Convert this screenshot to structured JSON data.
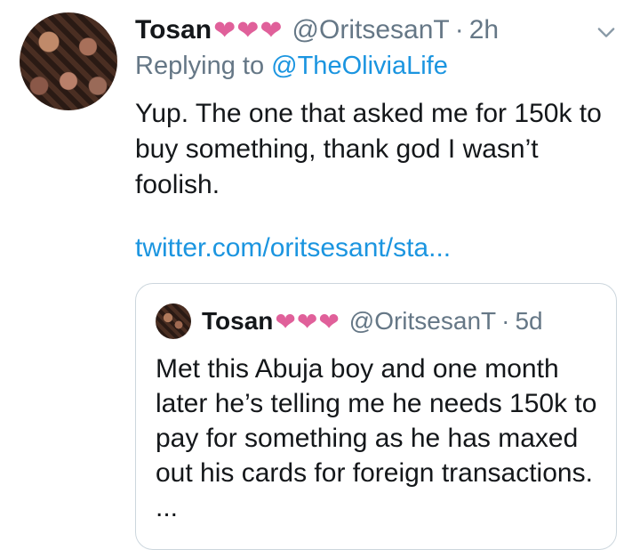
{
  "tweet": {
    "author_name": "Tosan",
    "hearts": "❤❤❤",
    "handle": "@OritsesanT",
    "separator": "·",
    "time": "2h",
    "replying_prefix": "Replying to",
    "replying_to": "@TheOliviaLife",
    "text": "Yup. The one that asked me for 150k to buy something, thank god I wasn’t foolish.",
    "link": "twitter.com/oritsesant/sta..."
  },
  "quote": {
    "author_name": "Tosan",
    "hearts": "❤❤❤",
    "handle": "@OritsesanT",
    "separator": "·",
    "time": "5d",
    "text": "Met this Abuja boy and one month later he’s telling me he needs 150k to pay for something as he has maxed out his cards for foreign transactions. ..."
  },
  "colors": {
    "heart": "#e0609a",
    "link": "#1b95e0",
    "muted": "#657786",
    "border": "#ccd6dd"
  },
  "icons": {
    "menu": "chevron-down-icon"
  }
}
